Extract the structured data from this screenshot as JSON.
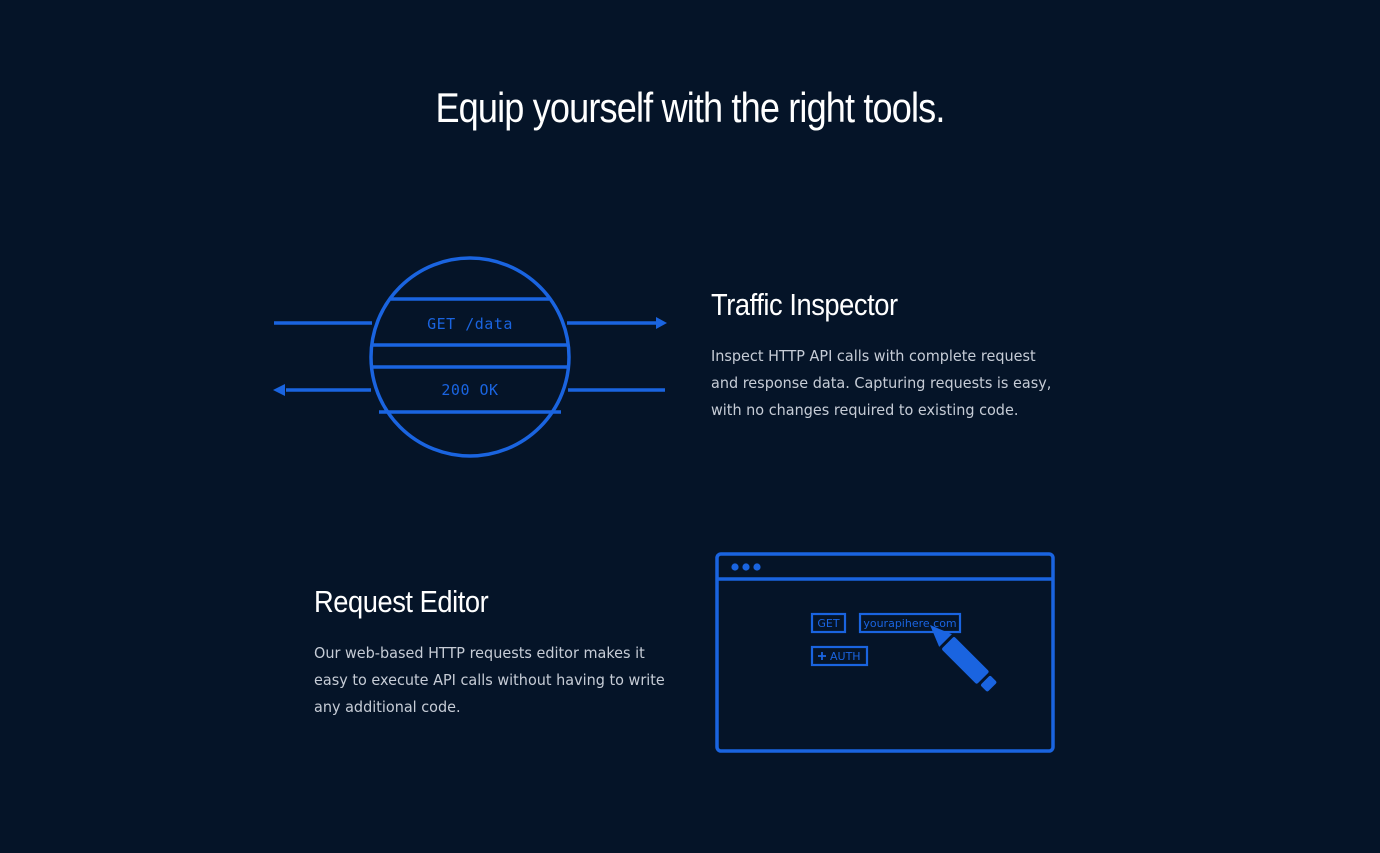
{
  "page": {
    "headline": "Equip yourself with the right tools."
  },
  "features": [
    {
      "title": "Traffic Inspector",
      "description": "Inspect HTTP API calls with complete request and response data. Capturing requests is easy, with no changes required to existing code.",
      "illustration": {
        "request_label": "GET /data",
        "response_label": "200 OK"
      }
    },
    {
      "title": "Request Editor",
      "description": "Our web-based HTTP requests editor makes it easy to execute API calls without having to write any additional code.",
      "illustration": {
        "method_chip": "GET",
        "url_chip": "yourapihere.com",
        "auth_chip": "AUTH",
        "auth_icon": "plus-icon",
        "cursor_icon": "pen-icon",
        "window_dots_icon": "window-dots-icon"
      }
    }
  ],
  "colors": {
    "background": "#051428",
    "accent": "#1a64e0",
    "headline_text": "#ffffff",
    "body_text": "#c6ccd6"
  }
}
